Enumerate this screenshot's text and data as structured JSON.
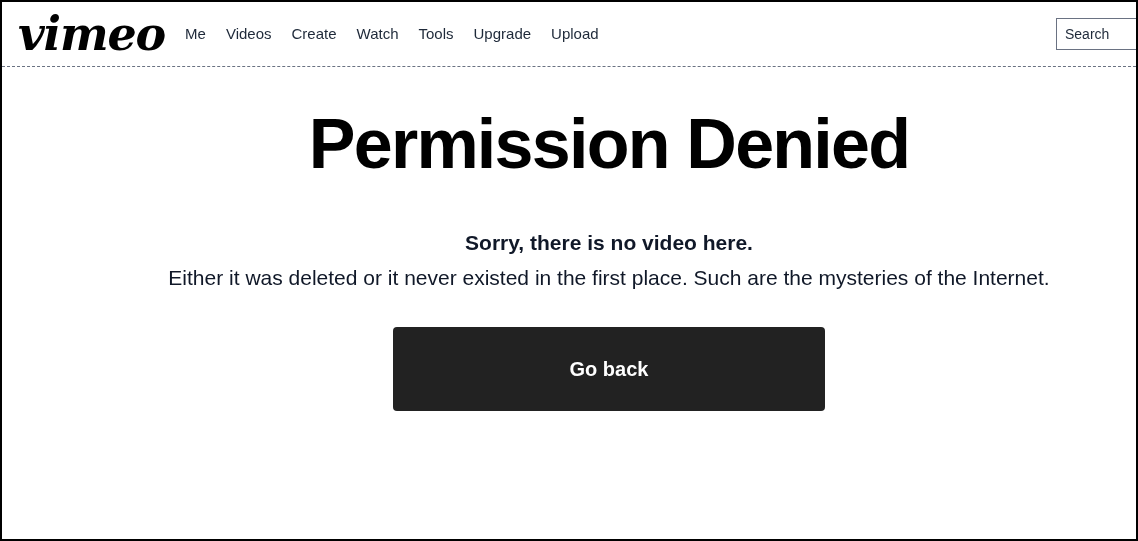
{
  "header": {
    "logo": "vimeo",
    "nav": [
      "Me",
      "Videos",
      "Create",
      "Watch",
      "Tools",
      "Upgrade",
      "Upload"
    ],
    "search": {
      "placeholder": "Search"
    }
  },
  "main": {
    "title": "Permission Denied",
    "subtitle": "Sorry, there is no video here.",
    "message": "Either it was deleted or it never existed in the first place. Such are the mysteries of the Internet.",
    "button": "Go back"
  }
}
